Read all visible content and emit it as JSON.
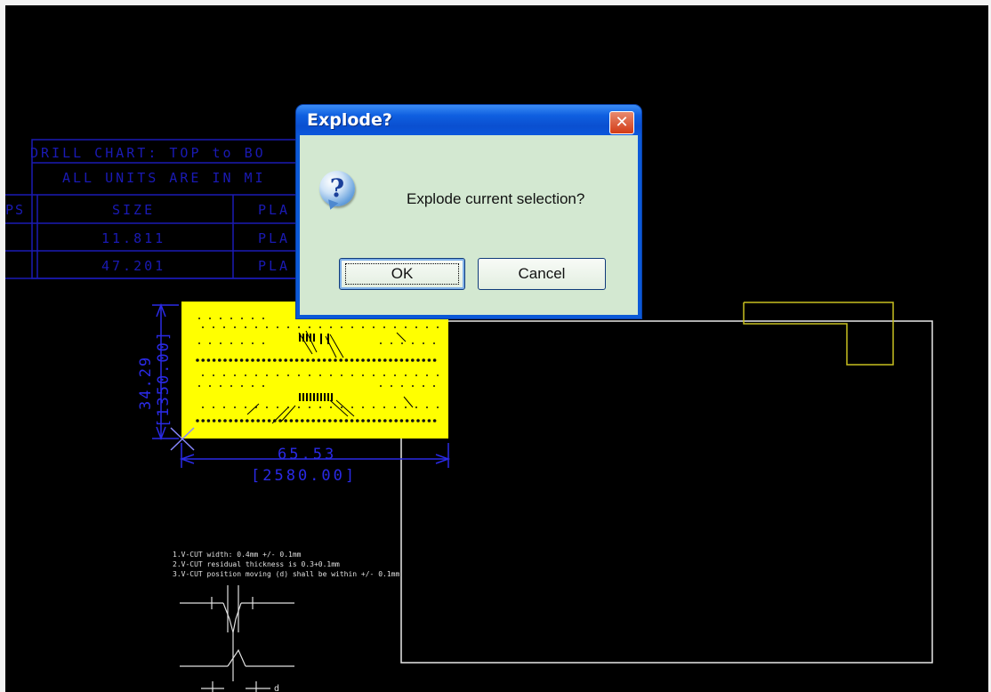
{
  "dialog": {
    "title": "Explode?",
    "close_glyph": "✕",
    "icon": "question-icon",
    "message": "Explode current selection?",
    "ok_label": "OK",
    "cancel_label": "Cancel"
  },
  "drawing": {
    "drill_chart": {
      "title": "DRILL CHART: TOP to BO",
      "subtitle": "ALL UNITS ARE IN MI",
      "col_hdr_left": "PS",
      "col_size": "SIZE",
      "col_plating": "PLA",
      "rows": [
        {
          "size": "11.811",
          "plating": "PLA"
        },
        {
          "size": "47.201",
          "plating": "PLA"
        }
      ]
    },
    "dim_height": "34.29",
    "dim_height_mil": "[1350.00]",
    "dim_width": "65.53",
    "dim_width_mil": "[2580.00]",
    "notes": [
      "1.V-CUT width: 0.4mm  +/- 0.1mm",
      "2.V-CUT residual thickness is 0.3+0.1mm",
      "3.V-CUT position moving (d) shall be within +/- 0.1mm"
    ],
    "vcut_label": "d",
    "colors": {
      "board": "#ffff00",
      "chart_lines": "#1a1ab4",
      "dimension": "#2a2ae6",
      "outline": "#e8e8e8",
      "highlight": "#c8c020"
    }
  }
}
